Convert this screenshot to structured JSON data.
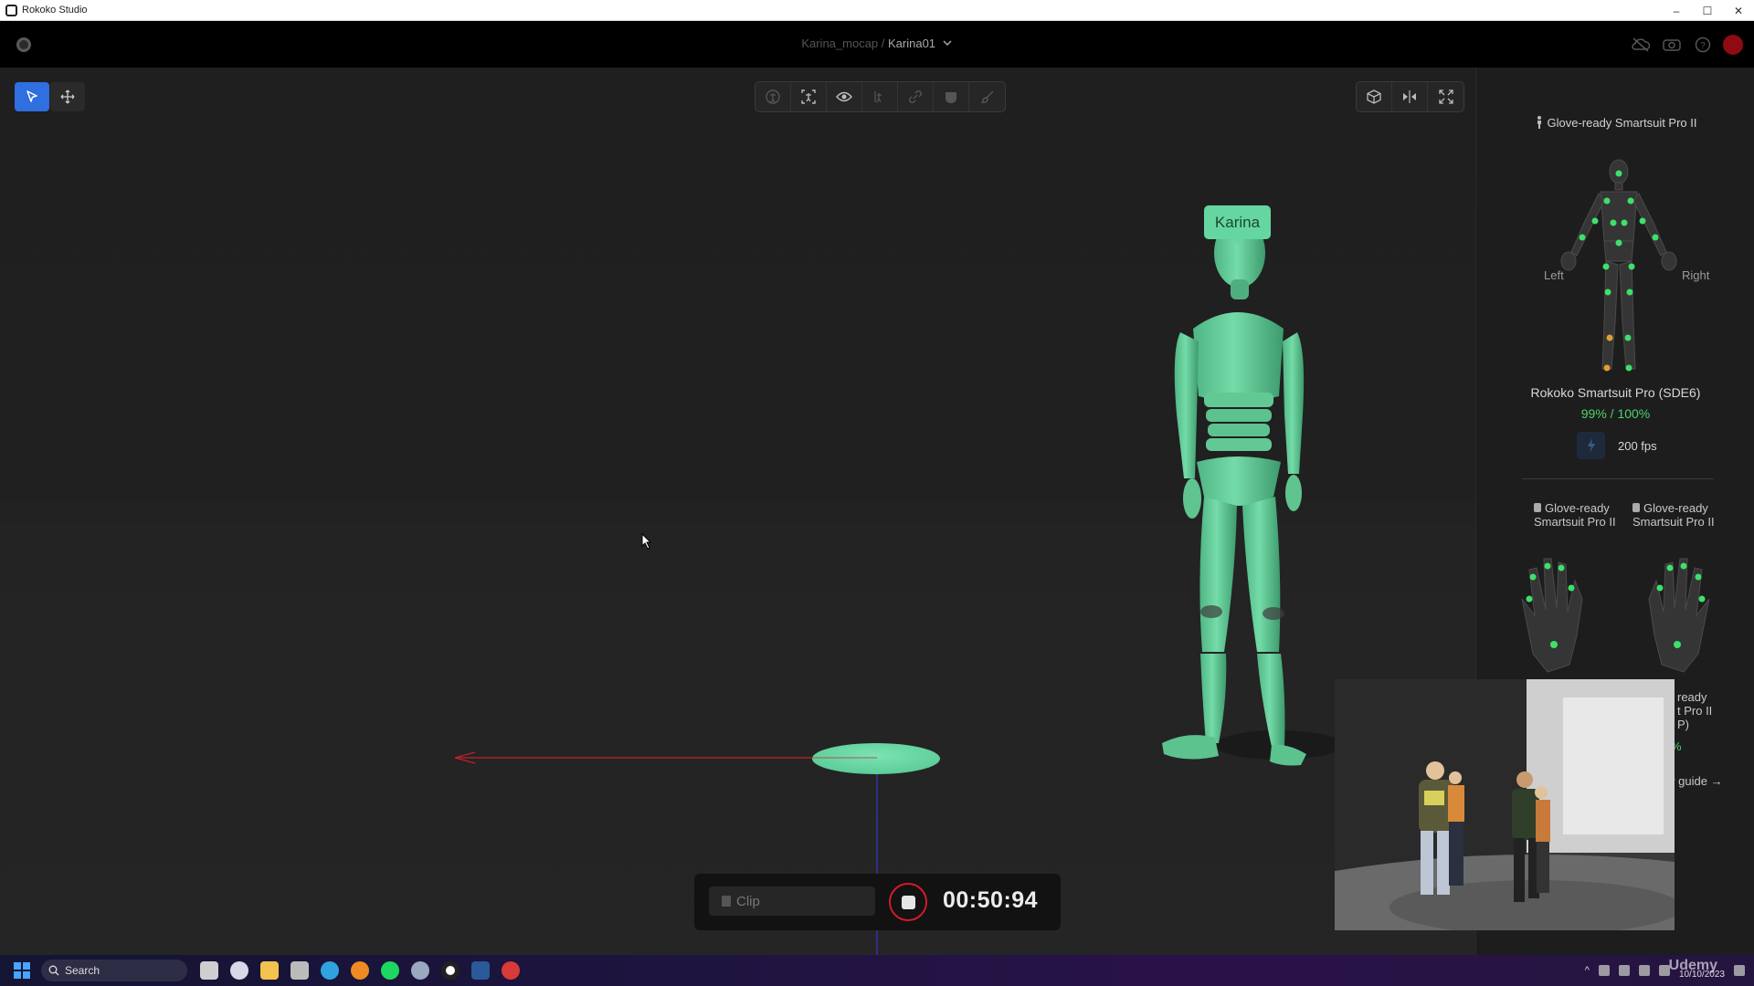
{
  "window": {
    "title": "Rokoko Studio",
    "controls": [
      "–",
      "☐",
      "✕"
    ]
  },
  "header": {
    "project": "Karina_mocap",
    "separator": " / ",
    "scene": "Karina01",
    "dropdown_icon": "chevron-down-icon"
  },
  "viewport": {
    "character_name": "Karina",
    "colors": {
      "accent": "#2f6fe0",
      "character": "#66d6a0",
      "axis_x": "#c0202e",
      "axis_y": "#3a36c8",
      "record": "#d11b2a"
    }
  },
  "record_bar": {
    "clip_placeholder": "Clip",
    "timer": "00:50:94"
  },
  "right_panel": {
    "suit_title": "Glove-ready Smartsuit Pro II",
    "left_label": "Left",
    "right_label": "Right",
    "suit_name": "Rokoko Smartsuit Pro (SDE6)",
    "battery": "99% / 100%",
    "fps": "200 fps",
    "glove_left_title": "Glove-ready Smartsuit Pro II",
    "glove_right_title": "Glove-ready Smartsuit Pro II",
    "peek_title": "ready\nt Pro II\nP)",
    "peek_pct": "%",
    "peek_guide": "ur guide →"
  },
  "taskbar": {
    "search_label": "Search",
    "date": "10/10/2023",
    "watermark": "Udemy"
  }
}
